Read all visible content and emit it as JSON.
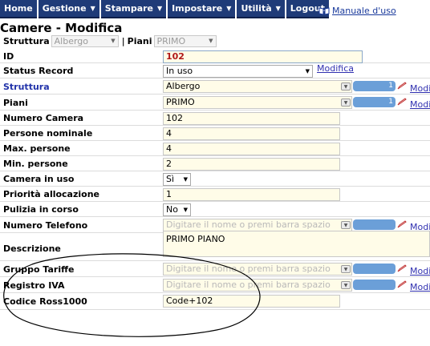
{
  "nav": {
    "items": [
      {
        "label": "Home",
        "dropdown": false
      },
      {
        "label": "Gestione",
        "dropdown": true
      },
      {
        "label": "Stampare",
        "dropdown": true
      },
      {
        "label": "Impostare",
        "dropdown": true
      },
      {
        "label": "Utilità",
        "dropdown": true
      },
      {
        "label": "Logout",
        "dropdown": false
      }
    ],
    "manual_link": "Manuale d'uso"
  },
  "page": {
    "title": "Camere - Modifica"
  },
  "filters": {
    "struttura_label": "Struttura",
    "struttura_value": "Albergo",
    "piani_label": "Piani",
    "piani_value": "PRIMO"
  },
  "form": {
    "id": {
      "label": "ID",
      "value": "102"
    },
    "status_record": {
      "label": "Status Record",
      "value": "In uso",
      "link": "Modifica"
    },
    "struttura": {
      "label": "Struttura",
      "value": "Albergo",
      "count": "1",
      "link": "Modi"
    },
    "piani": {
      "label": "Piani",
      "value": "PRIMO",
      "count": "1",
      "link": "Modi"
    },
    "numero_camera": {
      "label": "Numero Camera",
      "value": "102"
    },
    "persone_nominale": {
      "label": "Persone nominale",
      "value": "4"
    },
    "max_persone": {
      "label": "Max. persone",
      "value": "4"
    },
    "min_persone": {
      "label": "Min. persone",
      "value": "2"
    },
    "camera_in_uso": {
      "label": "Camera in uso",
      "value": "Sì"
    },
    "priorita_allocazione": {
      "label": "Priorità allocazione",
      "value": "1"
    },
    "pulizia_in_corso": {
      "label": "Pulizia in corso",
      "value": "No"
    },
    "numero_telefono": {
      "label": "Numero Telefono",
      "placeholder": "Digitare il nome o premi barra spazio",
      "link": "Modi"
    },
    "descrizione": {
      "label": "Descrizione",
      "value": "PRIMO PIANO"
    },
    "gruppo_tariffe": {
      "label": "Gruppo Tariffe",
      "placeholder": "Digitare il nome o premi barra spazio",
      "link": "Modi"
    },
    "registro_iva": {
      "label": "Registro IVA",
      "placeholder": "Digitare il nome o premi barra spazio",
      "link": "Modi"
    },
    "codice_ross1000": {
      "label": "Codice Ross1000",
      "value": "Code+102"
    }
  },
  "colors": {
    "nav_bg": "#1f3b78",
    "field_bg": "#fffce8",
    "pill": "#6b9fd8",
    "id_value": "#b01818",
    "link": "#3030b0"
  }
}
